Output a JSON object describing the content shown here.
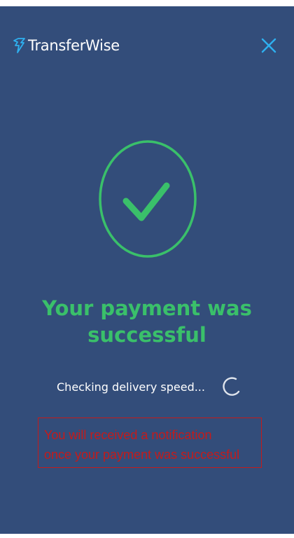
{
  "header": {
    "brand_name": "TransferWise",
    "close_icon": "close-icon"
  },
  "colors": {
    "background": "#334d7a",
    "accent_green": "#3ac06a",
    "close_blue": "#2eb0ef",
    "notice_red": "#c41b1b"
  },
  "status": {
    "success_icon": "checkmark-circle-icon",
    "headline_line1": "Your payment was",
    "headline_line2": "successful",
    "checking_text": "Checking delivery speed...",
    "spinner_icon": "loading-spinner-icon"
  },
  "notice": {
    "line1": "You will received a notification",
    "line2": "once your payment was successful"
  }
}
